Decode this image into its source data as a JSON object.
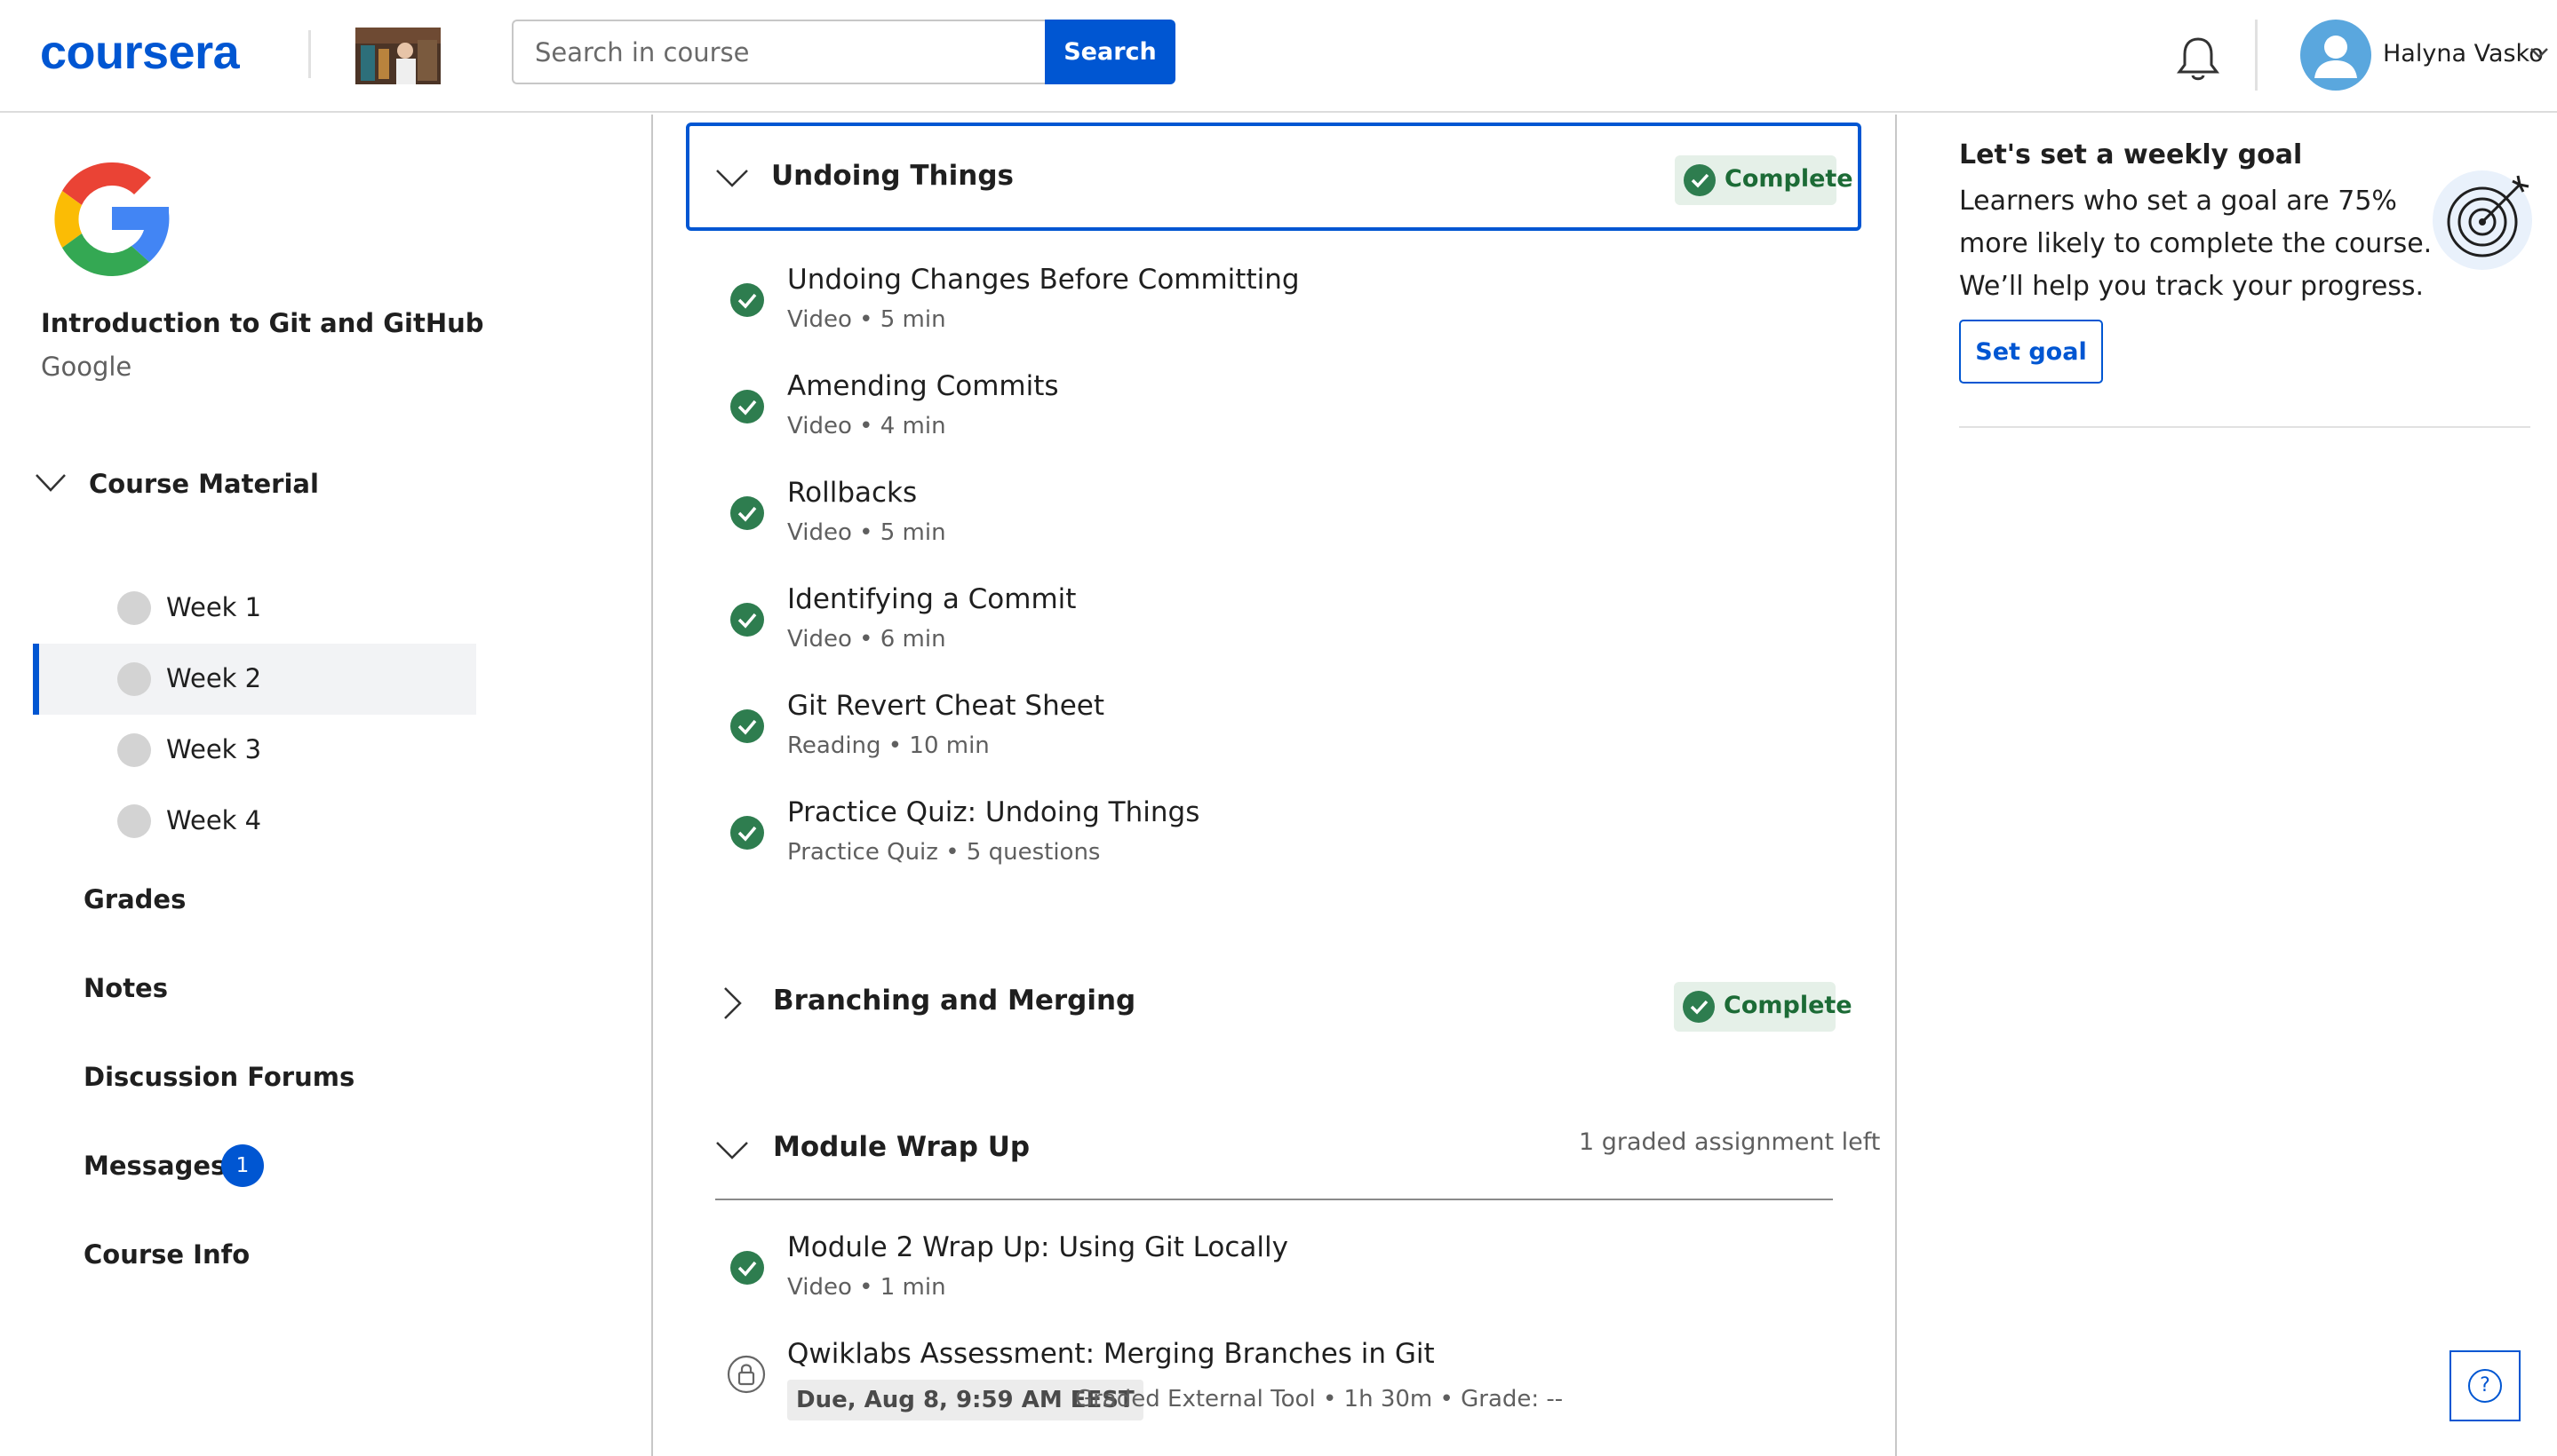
{
  "header": {
    "logo": "coursera",
    "search": {
      "placeholder": "Search in course",
      "button_label": "Search"
    },
    "user": {
      "name": "Halyna Vasko"
    }
  },
  "sidebar": {
    "course_title": "Introduction to Git and GitHub",
    "course_org": "Google",
    "course_material_label": "Course Material",
    "weeks": [
      {
        "label": "Week 1",
        "active": false
      },
      {
        "label": "Week 2",
        "active": true
      },
      {
        "label": "Week 3",
        "active": false
      },
      {
        "label": "Week 4",
        "active": false
      }
    ],
    "links": [
      {
        "label": "Grades"
      },
      {
        "label": "Notes"
      },
      {
        "label": "Discussion Forums"
      },
      {
        "label": "Messages",
        "badge": "1"
      },
      {
        "label": "Course Info"
      }
    ]
  },
  "main": {
    "sections": [
      {
        "title": "Undoing Things",
        "status": "Complete",
        "expanded": true,
        "items": [
          {
            "title": "Undoing Changes Before Committing",
            "meta": "Video • 5 min"
          },
          {
            "title": "Amending Commits",
            "meta": "Video • 4 min"
          },
          {
            "title": "Rollbacks",
            "meta": "Video • 5 min"
          },
          {
            "title": "Identifying a Commit",
            "meta": "Video • 6 min"
          },
          {
            "title": "Git Revert Cheat Sheet",
            "meta": "Reading • 10 min"
          },
          {
            "title": "Practice Quiz: Undoing Things",
            "meta": "Practice Quiz • 5 questions"
          }
        ]
      },
      {
        "title": "Branching and Merging",
        "status": "Complete",
        "expanded": false
      },
      {
        "title": "Module Wrap Up",
        "summary": "1 graded assignment left",
        "expanded": true,
        "items": [
          {
            "title": "Module 2 Wrap Up: Using Git Locally",
            "meta": "Video • 1 min"
          },
          {
            "title": "Qwiklabs Assessment: Merging Branches in Git",
            "due": "Due, Aug 8, 9:59 AM EEST",
            "meta": "Graded External Tool • 1h 30m • Grade: --"
          }
        ]
      }
    ]
  },
  "goal_panel": {
    "title": "Let's set a weekly goal",
    "text": "Learners who set a goal are 75% more likely to complete the course. We’ll help you track your progress.",
    "button_label": "Set goal"
  },
  "help": {
    "label": "?"
  },
  "colors": {
    "brand": "#0056d2",
    "complete_green": "#2e7d4f",
    "complete_bg": "#e5f0e8"
  }
}
